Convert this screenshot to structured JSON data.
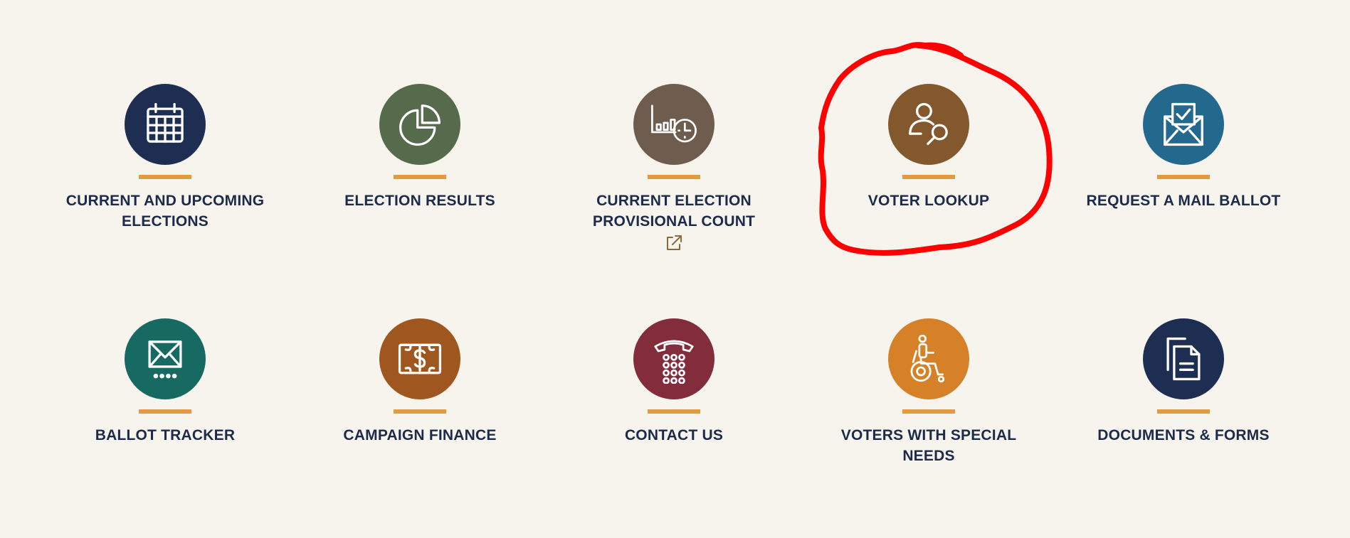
{
  "accent_bar_color": "#e39b3f",
  "label_color": "#1c2b4b",
  "background_color": "#f7f4ed",
  "annotation_color": "#ff0000",
  "tiles": [
    {
      "label": "CURRENT AND UPCOMING ELECTIONS",
      "icon": "calendar-icon",
      "color": "#1e2e52"
    },
    {
      "label": "ELECTION RESULTS",
      "icon": "pie-chart-icon",
      "color": "#566b4b"
    },
    {
      "label": "CURRENT ELECTION PROVISIONAL COUNT",
      "icon": "chart-clock-icon",
      "color": "#6e5c4f",
      "external": true
    },
    {
      "label": "VOTER LOOKUP",
      "icon": "person-search-icon",
      "color": "#83582d"
    },
    {
      "label": "REQUEST A MAIL BALLOT",
      "icon": "mail-check-icon",
      "color": "#23698d"
    },
    {
      "label": "BALLOT TRACKER",
      "icon": "envelope-dots-icon",
      "color": "#176a62"
    },
    {
      "label": "CAMPAIGN FINANCE",
      "icon": "dollar-bill-icon",
      "color": "#a0561f"
    },
    {
      "label": "CONTACT US",
      "icon": "phone-icon",
      "color": "#832c3b"
    },
    {
      "label": "VOTERS WITH SPECIAL NEEDS",
      "icon": "wheelchair-icon",
      "color": "#d68128"
    },
    {
      "label": "DOCUMENTS & FORMS",
      "icon": "documents-icon",
      "color": "#1e2e52"
    }
  ]
}
